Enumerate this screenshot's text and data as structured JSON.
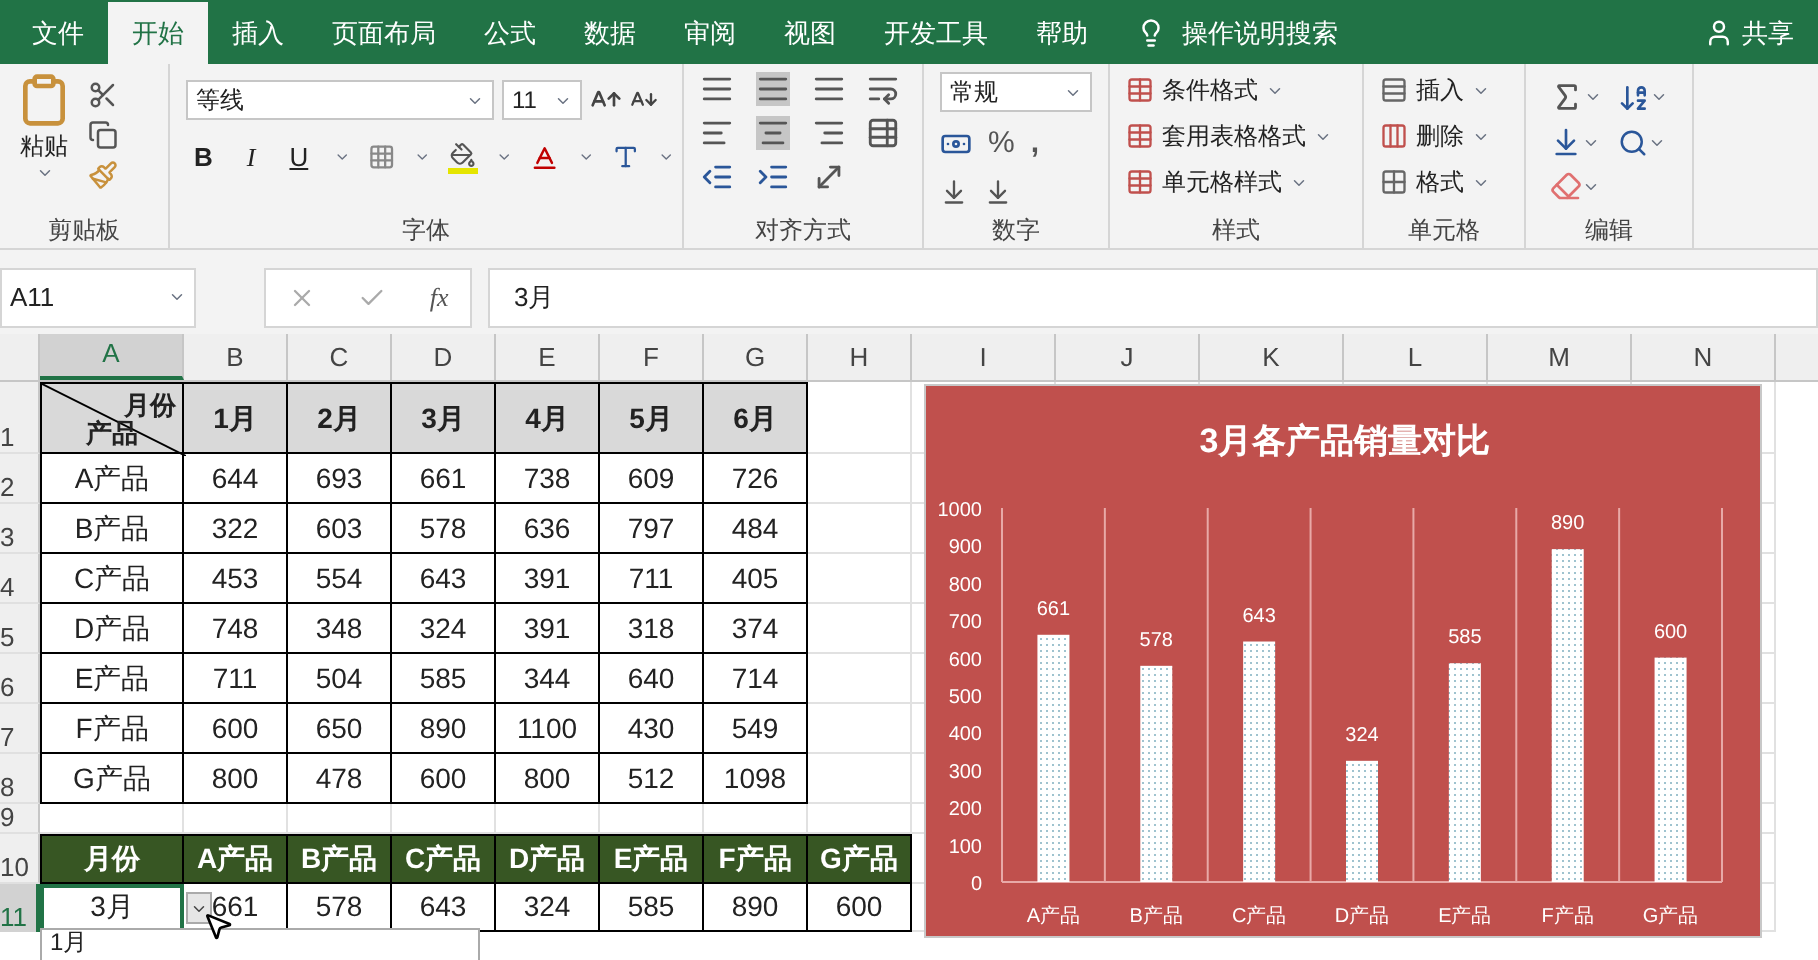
{
  "ribbon_tabs": [
    {
      "label": "文件",
      "selected": false
    },
    {
      "label": "开始",
      "selected": true
    },
    {
      "label": "插入",
      "selected": false
    },
    {
      "label": "页面布局",
      "selected": false
    },
    {
      "label": "公式",
      "selected": false
    },
    {
      "label": "数据",
      "selected": false
    },
    {
      "label": "审阅",
      "selected": false
    },
    {
      "label": "视图",
      "selected": false
    },
    {
      "label": "开发工具",
      "selected": false
    },
    {
      "label": "帮助",
      "selected": false
    }
  ],
  "tell_me": "操作说明搜索",
  "share": "共享",
  "clipboard": {
    "paste": "粘贴",
    "label": "剪贴板"
  },
  "font": {
    "name": "等线",
    "size": "11",
    "bold": "B",
    "italic": "I",
    "underline": "U",
    "label": "字体"
  },
  "alignment": {
    "label": "对齐方式"
  },
  "number": {
    "format": "常规",
    "percent": "%",
    "comma": ",",
    "label": "数字"
  },
  "styles": {
    "items": [
      "条件格式",
      "套用表格格式",
      "单元格样式"
    ],
    "label": "样式"
  },
  "cells": {
    "items": [
      "插入",
      "删除",
      "格式"
    ],
    "label": "单元格"
  },
  "editing": {
    "label": "编辑"
  },
  "formula_bar": {
    "name_box": "A11",
    "fx": "fx",
    "formula": "3月"
  },
  "columns": [
    {
      "label": "A",
      "selected": true
    },
    {
      "label": "B",
      "selected": false
    },
    {
      "label": "C",
      "selected": false
    },
    {
      "label": "D",
      "selected": false
    },
    {
      "label": "E",
      "selected": false
    },
    {
      "label": "F",
      "selected": false
    },
    {
      "label": "G",
      "selected": false
    },
    {
      "label": "H",
      "selected": false
    },
    {
      "label": "I",
      "selected": false
    },
    {
      "label": "J",
      "selected": false
    },
    {
      "label": "K",
      "selected": false
    },
    {
      "label": "L",
      "selected": false
    },
    {
      "label": "M",
      "selected": false
    },
    {
      "label": "N",
      "selected": false
    }
  ],
  "rows": [
    {
      "label": "1",
      "selected": false
    },
    {
      "label": "2",
      "selected": false
    },
    {
      "label": "3",
      "selected": false
    },
    {
      "label": "4",
      "selected": false
    },
    {
      "label": "5",
      "selected": false
    },
    {
      "label": "6",
      "selected": false
    },
    {
      "label": "7",
      "selected": false
    },
    {
      "label": "8",
      "selected": false
    },
    {
      "label": "9",
      "selected": false
    },
    {
      "label": "10",
      "selected": false
    },
    {
      "label": "11",
      "selected": true
    }
  ],
  "sales_table": {
    "corner_top": "月份",
    "corner_bottom": "产品",
    "headers": [
      "1月",
      "2月",
      "3月",
      "4月",
      "5月",
      "6月"
    ],
    "rows": [
      {
        "product": "A产品",
        "values": [
          "644",
          "693",
          "661",
          "738",
          "609",
          "726"
        ]
      },
      {
        "product": "B产品",
        "values": [
          "322",
          "603",
          "578",
          "636",
          "797",
          "484"
        ]
      },
      {
        "product": "C产品",
        "values": [
          "453",
          "554",
          "643",
          "391",
          "711",
          "405"
        ]
      },
      {
        "product": "D产品",
        "values": [
          "748",
          "348",
          "324",
          "391",
          "318",
          "374"
        ]
      },
      {
        "product": "E产品",
        "values": [
          "711",
          "504",
          "585",
          "344",
          "640",
          "714"
        ]
      },
      {
        "product": "F产品",
        "values": [
          "600",
          "650",
          "890",
          "1100",
          "430",
          "549"
        ]
      },
      {
        "product": "G产品",
        "values": [
          "800",
          "478",
          "600",
          "800",
          "512",
          "1098"
        ]
      }
    ]
  },
  "lookup_table": {
    "headers": [
      "月份",
      "A产品",
      "B产品",
      "C产品",
      "D产品",
      "E产品",
      "F产品",
      "G产品"
    ],
    "values": [
      "3月",
      "661",
      "578",
      "643",
      "324",
      "585",
      "890",
      "600"
    ]
  },
  "dropdown": {
    "items": [
      "1月"
    ]
  },
  "chart": {
    "chart_data": {
      "type": "bar",
      "title": "3月各产品销量对比",
      "categories": [
        "A产品",
        "B产品",
        "C产品",
        "D产品",
        "E产品",
        "F产品",
        "G产品"
      ],
      "series": [
        {
          "color": "#ffffff",
          "values": [
            661,
            578,
            643,
            324,
            585,
            890,
            600
          ]
        }
      ],
      "ylim": [
        0,
        1000
      ],
      "yticks": [
        0,
        100,
        200,
        300,
        400,
        500,
        600,
        700,
        800,
        900,
        1000
      ],
      "data_labels": true
    }
  }
}
